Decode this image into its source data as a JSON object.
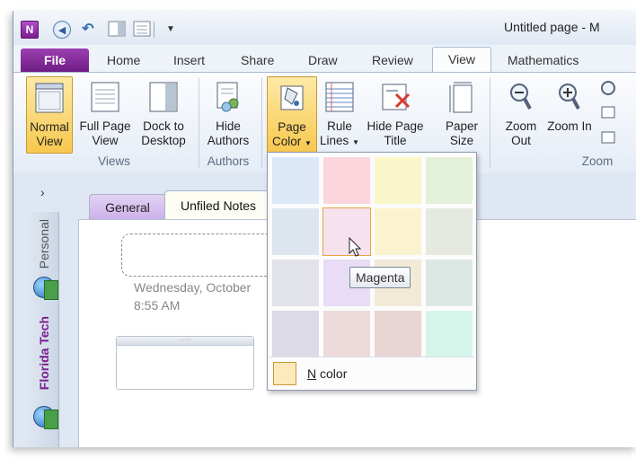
{
  "title_bar": {
    "app_icon_letter": "N",
    "window_title": "Untitled page - M"
  },
  "tabs": [
    {
      "label": "File"
    },
    {
      "label": "Home"
    },
    {
      "label": "Insert"
    },
    {
      "label": "Share"
    },
    {
      "label": "Draw"
    },
    {
      "label": "Review"
    },
    {
      "label": "View"
    },
    {
      "label": "Mathematics"
    }
  ],
  "active_tab": "View",
  "ribbon": {
    "views": {
      "normal_view": "Normal View",
      "full_page_view": "Full Page View",
      "dock_to_desktop": "Dock to Desktop",
      "group_label": "Views"
    },
    "authors": {
      "hide_authors": "Hide Authors",
      "group_label": "Authors"
    },
    "page_setup": {
      "page_color": "Page Color",
      "rule_lines": "Rule Lines",
      "hide_page_title": "Hide Page Title",
      "paper_size": "Paper Size"
    },
    "zoom": {
      "zoom_out": "Zoom Out",
      "zoom_in": "Zoom In",
      "group_label": "Zoom"
    }
  },
  "notebooks": [
    {
      "name": "Personal"
    },
    {
      "name": "Florida Tech"
    }
  ],
  "sections": [
    {
      "name": "General",
      "color": "#d9c3f0"
    },
    {
      "name": "Unfiled Notes",
      "color": "#fdfdf3"
    }
  ],
  "page": {
    "date": "Wednesday, October",
    "time": "8:55 AM"
  },
  "page_color_menu": {
    "swatches": [
      {
        "color": "#dce8f8"
      },
      {
        "color": "#fbd6dc"
      },
      {
        "color": "#f9f7c9"
      },
      {
        "color": "#e4f1d9"
      },
      {
        "color": "#dde6ee"
      },
      {
        "color": "#f6e1ee",
        "selected": true
      },
      {
        "color": "#fbf3cf"
      },
      {
        "color": "#e5e9df"
      },
      {
        "color": "#e1e3e8"
      },
      {
        "color": "#e8dcf6"
      },
      {
        "color": "#f2ead7"
      },
      {
        "color": "#dde8e5"
      },
      {
        "color": "#dcdae6"
      },
      {
        "color": "#eedada"
      },
      {
        "color": "#e9d5d3"
      },
      {
        "color": "#d6f5ea"
      }
    ],
    "hovered_tooltip": "Magenta",
    "no_color_label": "No color",
    "no_color_mnemonic": "N"
  },
  "colors": {
    "file_tab": "#7a2490",
    "highlight": "#f8c84e"
  }
}
